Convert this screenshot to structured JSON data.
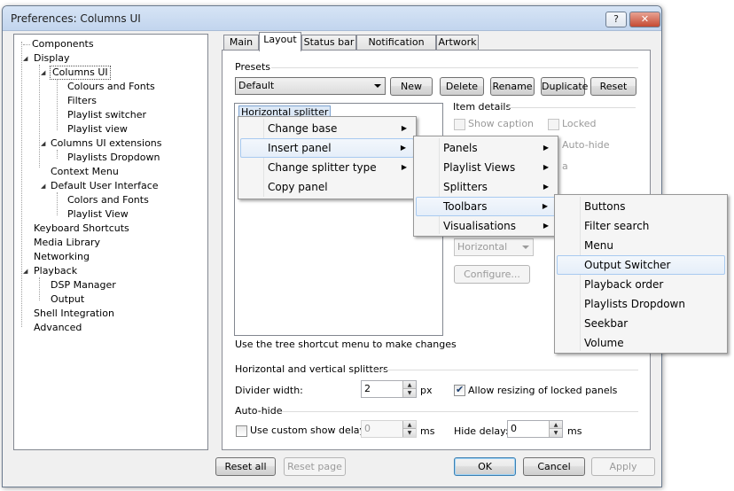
{
  "window": {
    "title": "Preferences: Columns UI",
    "help": "?",
    "close": "✕"
  },
  "tree": {
    "items": [
      "Components",
      "Display",
      "Columns UI",
      "Colours and Fonts",
      "Filters",
      "Playlist switcher",
      "Playlist view",
      "Columns UI extensions",
      "Playlists Dropdown",
      "Context Menu",
      "Default User Interface",
      "Colors and Fonts",
      "Playlist View",
      "Keyboard Shortcuts",
      "Media Library",
      "Networking",
      "Playback",
      "DSP Manager",
      "Output",
      "Shell Integration",
      "Advanced"
    ],
    "expander": "◢"
  },
  "tabs": [
    "Main",
    "Layout",
    "Status bar",
    "Notification area",
    "Artwork"
  ],
  "presets": {
    "heading": "Presets",
    "selected": "Default",
    "buttons": {
      "new": "New",
      "delete": "Delete",
      "rename": "Rename",
      "duplicate": "Duplicate",
      "reset": "Reset"
    }
  },
  "layout": {
    "root_node": "Horizontal splitter",
    "hint": "Use the tree shortcut menu to make changes"
  },
  "item_details": {
    "heading": "Item details",
    "show_caption": "Show caption",
    "locked": "Locked",
    "auto_hide_partial": "Auto-hide",
    "partial_a": "a",
    "orientation": "Horizontal",
    "configure": "Configure..."
  },
  "splitters": {
    "heading": "Horizontal and vertical splitters",
    "divider_label": "Divider width:",
    "divider_value": "2",
    "divider_unit": "px",
    "allow_resizing": "Allow resizing of locked panels"
  },
  "autohide": {
    "heading": "Auto-hide",
    "custom_show": "Use custom show delay:",
    "show_value": "0",
    "show_unit": "ms",
    "hide_label": "Hide delay:",
    "hide_value": "0",
    "hide_unit": "ms"
  },
  "footer": {
    "reset_all": "Reset all",
    "reset_page": "Reset page",
    "ok": "OK",
    "cancel": "Cancel",
    "apply": "Apply"
  },
  "context_menu": {
    "items": [
      "Change base",
      "Insert panel",
      "Change splitter type",
      "Copy panel"
    ]
  },
  "insert_menu": {
    "items": [
      "Panels",
      "Playlist Views",
      "Splitters",
      "Toolbars",
      "Visualisations"
    ]
  },
  "toolbars_menu": {
    "items": [
      "Buttons",
      "Filter search",
      "Menu",
      "Output Switcher",
      "Playback order",
      "Playlists Dropdown",
      "Seekbar",
      "Volume"
    ]
  },
  "submenu_arrow": "▶",
  "spin_up": "▲",
  "spin_down": "▼"
}
